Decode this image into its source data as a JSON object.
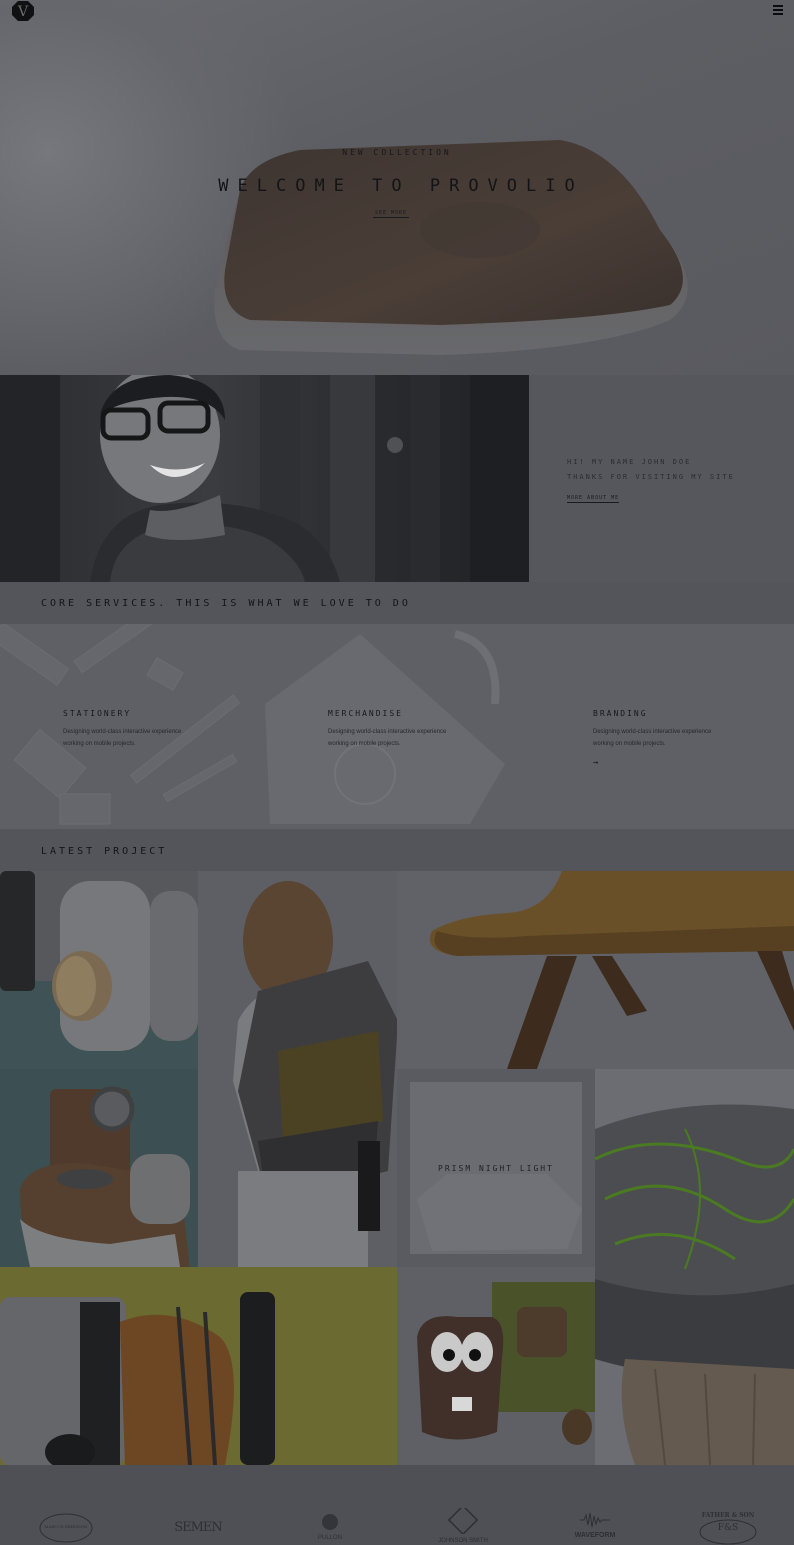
{
  "header": {
    "logo_letter": "V",
    "menu_icon": "hamburger-icon"
  },
  "hero": {
    "kicker": "NEW COLLECTION",
    "title": "WELCOME TO PROVOLIO",
    "link": "SEE MORE"
  },
  "about": {
    "greeting_line1": "HI! MY NAME JOHN DOE",
    "greeting_line2": "THANKS FOR VISITING MY SITE",
    "link": "MORE ABOUT ME"
  },
  "services": {
    "heading": "CORE SERVICES. THIS IS WHAT WE LOVE TO DO",
    "items": [
      {
        "title": "STATIONERY",
        "line1": "Designing world-class interactive experience",
        "line2": "working on mobile projects."
      },
      {
        "title": "MERCHANDISE",
        "line1": "Designing world-class interactive experience",
        "line2": "working on mobile projects."
      },
      {
        "title": "BRANDING",
        "line1": "Designing world-class interactive experience",
        "line2": "working on mobile projects."
      }
    ],
    "arrow": "→"
  },
  "projects": {
    "heading": "LATEST PROJECT",
    "featured_caption": "PRISM NIGHT LIGHT"
  },
  "clients": {
    "logos": [
      {
        "name": "MARCUS ERIKSSON",
        "text": "MARCUS ERIKSSON"
      },
      {
        "name": "SEMEN",
        "text": "SEMEN"
      },
      {
        "name": "PULLON",
        "text": "PULLON"
      },
      {
        "name": "JOHNSON SMITH",
        "text": "JOHNSON SMITH"
      },
      {
        "name": "WAVEFORM",
        "text": "WAVEFORM"
      },
      {
        "name": "FATHER & SON",
        "text": "FATHER & SON"
      }
    ],
    "fs_mark": "F&S"
  },
  "colors": {
    "overlay": "#53555a",
    "green_stitch": "#5fb82d",
    "olive": "#8c8a2e",
    "teal": "#3e6b70"
  }
}
